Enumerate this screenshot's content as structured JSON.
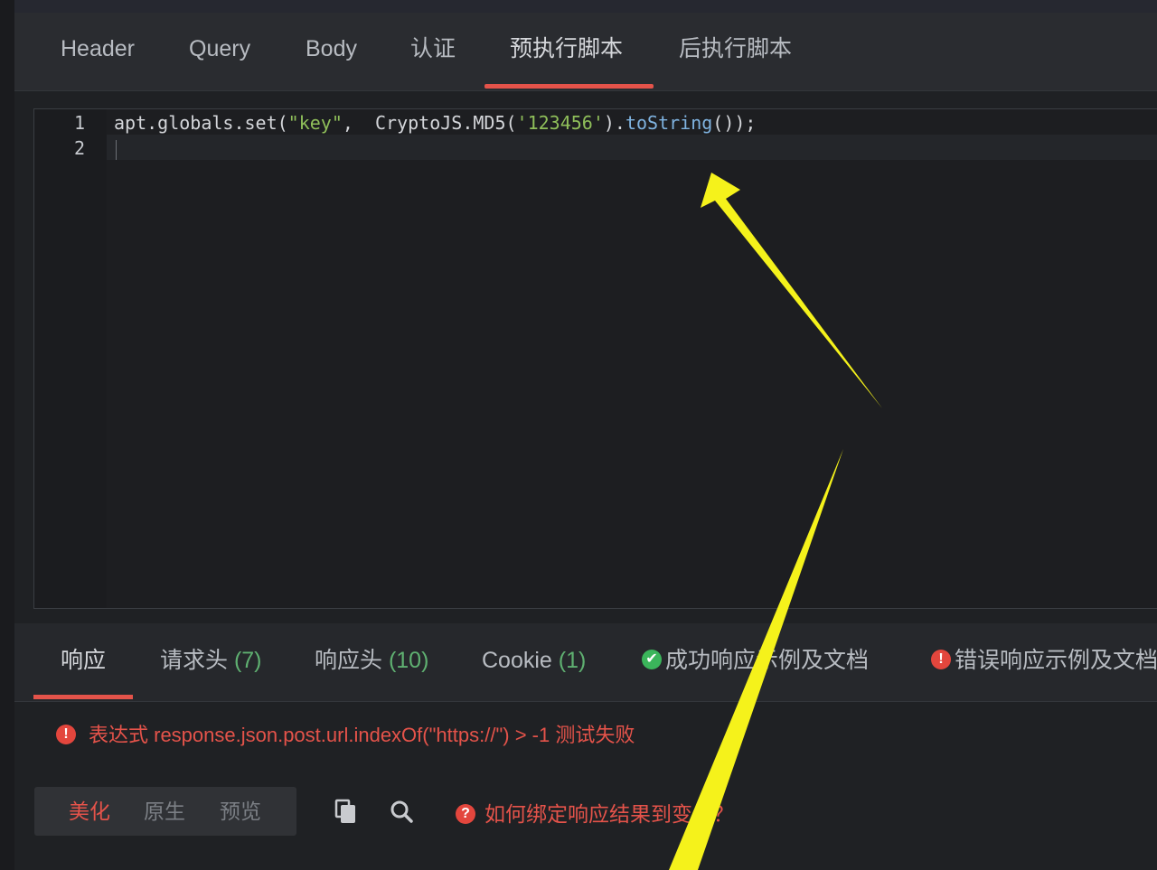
{
  "request_tabs": [
    {
      "label": "Header"
    },
    {
      "label": "Query"
    },
    {
      "label": "Body"
    },
    {
      "label": "认证"
    },
    {
      "label": "预执行脚本",
      "active": true
    },
    {
      "label": "后执行脚本"
    }
  ],
  "editor": {
    "line_numbers": [
      "1",
      "2"
    ],
    "code": {
      "part1": "apt.globals.set(",
      "str_key": "\"key\"",
      "part2": ",  CryptoJS.MD5(",
      "str_val": "'123456'",
      "part3": ").",
      "fn": "toString",
      "part4": "());"
    }
  },
  "response_tabs": [
    {
      "label": "响应",
      "active": true
    },
    {
      "label": "请求头 ",
      "count": "(7)"
    },
    {
      "label": "响应头 ",
      "count": "(10)"
    },
    {
      "label": "Cookie ",
      "count": "(1)"
    },
    {
      "label": "成功响应示例及文档",
      "icon": "check-circle-icon"
    },
    {
      "label": "错误响应示例及文档",
      "icon": "exclamation-circle-icon"
    }
  ],
  "error_message": "表达式 response.json.post.url.indexOf(\"https://\") > -1 测试失败",
  "view_modes": [
    "美化",
    "原生",
    "预览"
  ],
  "active_view_mode": "美化",
  "help_link": "如何绑定响应结果到变量？",
  "colors": {
    "accent": "#e4534a",
    "success": "#3bb55b",
    "background": "#1f2124",
    "annotation_arrow": "#f5f21b"
  }
}
